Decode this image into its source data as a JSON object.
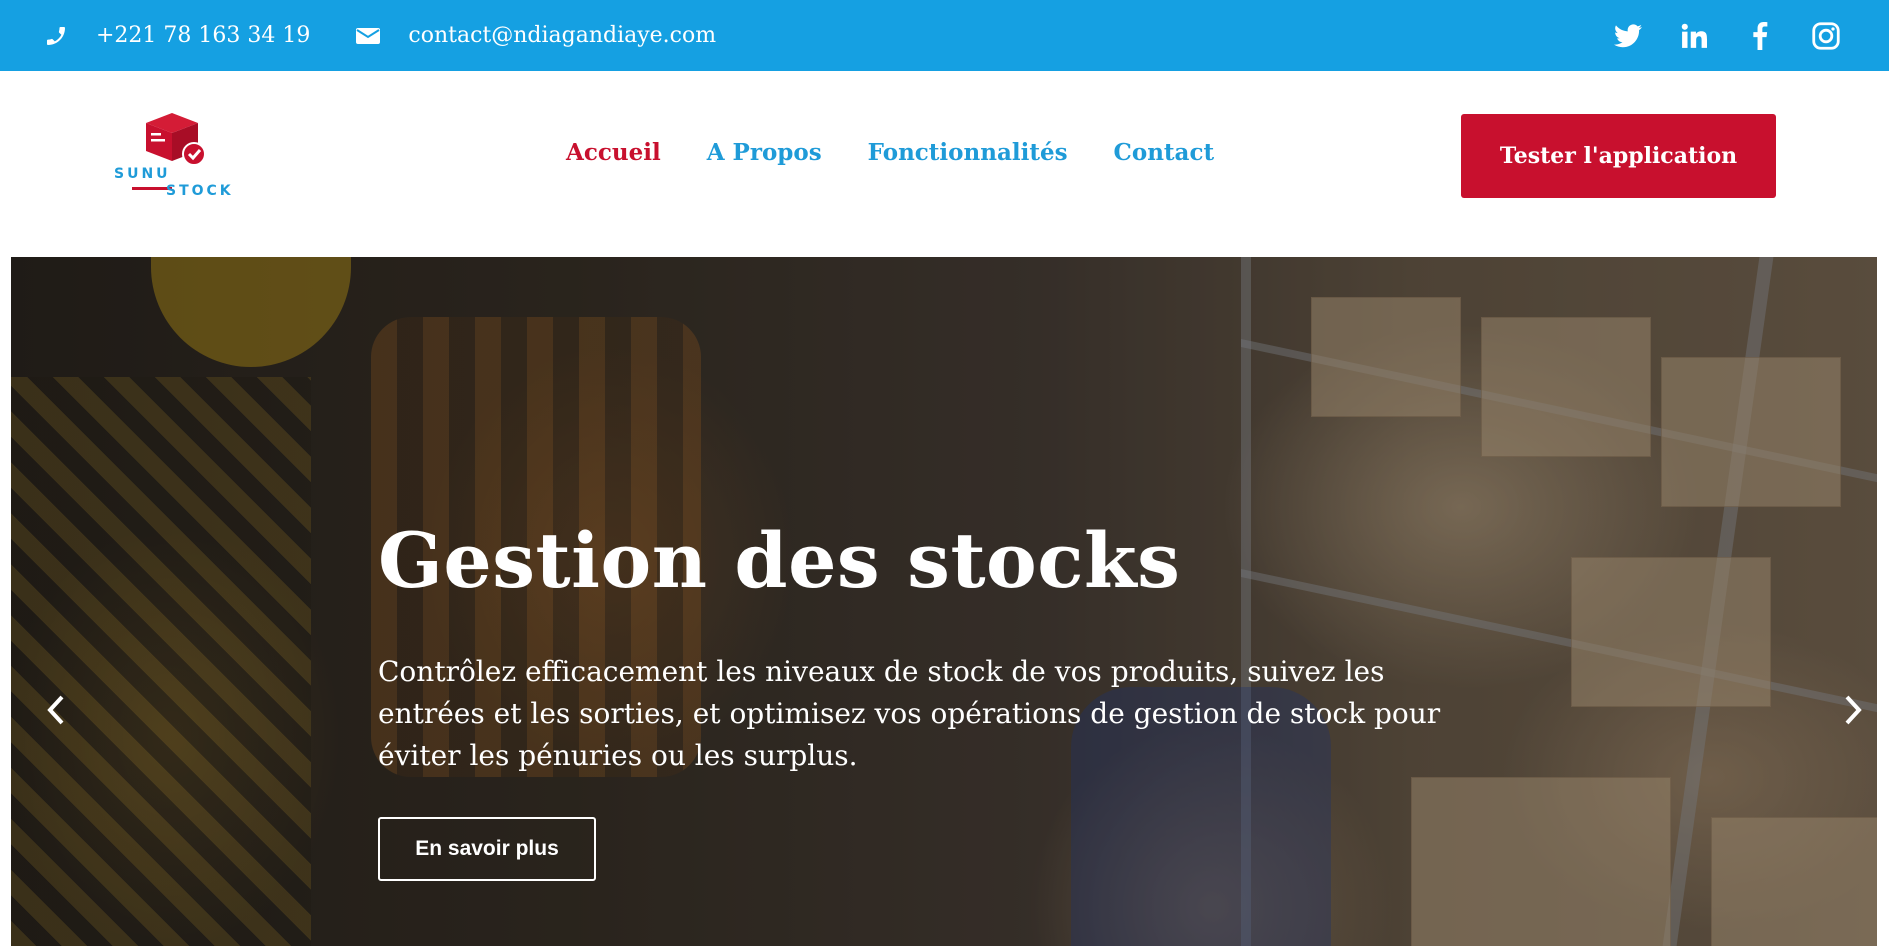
{
  "topbar": {
    "phone": "+221 78 163 34 19",
    "email": "contact@ndiagandiaye.com",
    "phone_icon": "phone-icon",
    "email_icon": "envelope-icon",
    "socials": [
      "twitter-icon",
      "linkedin-icon",
      "facebook-icon",
      "instagram-icon"
    ],
    "background": "#15a0e2"
  },
  "logo": {
    "word1": "SUNU",
    "word2": "STOCK",
    "brand_red": "#c8102e",
    "brand_blue": "#1f9bd8"
  },
  "nav": {
    "items": [
      {
        "label": "Accueil",
        "active": true
      },
      {
        "label": "A Propos"
      },
      {
        "label": "Fonctionnalités"
      },
      {
        "label": "Contact"
      }
    ]
  },
  "cta": {
    "label": "Tester l'application"
  },
  "hero": {
    "title": "Gestion des stocks",
    "text": "Contrôlez efficacement les niveaux de stock de vos produits, suivez les entrées et les sorties, et optimisez vos opérations de gestion de stock pour éviter les pénuries ou les surplus.",
    "button": "En savoir plus",
    "prev_icon": "chevron-left-icon",
    "next_icon": "chevron-right-icon"
  }
}
